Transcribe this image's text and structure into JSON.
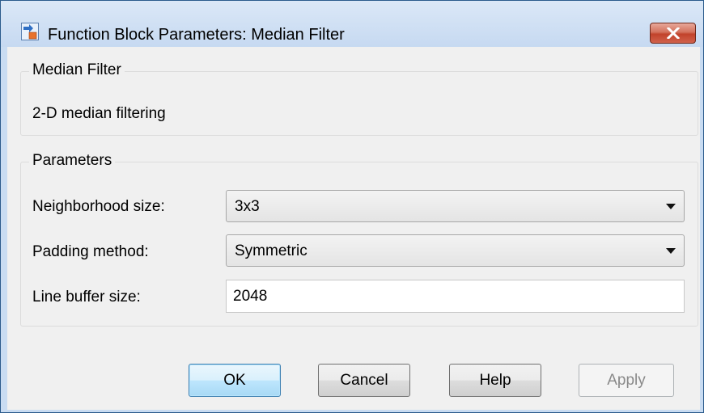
{
  "window": {
    "title": "Function Block Parameters: Median Filter"
  },
  "block_group": {
    "legend": "Median Filter",
    "description": "2-D median filtering"
  },
  "parameters_group": {
    "legend": "Parameters",
    "fields": [
      {
        "label": "Neighborhood size:",
        "value": "3x3",
        "type": "dropdown"
      },
      {
        "label": "Padding method:",
        "value": "Symmetric",
        "type": "dropdown"
      },
      {
        "label": "Line buffer size:",
        "value": "2048",
        "type": "text"
      }
    ]
  },
  "buttons": {
    "ok": "OK",
    "cancel": "Cancel",
    "help": "Help",
    "apply": "Apply"
  },
  "colors": {
    "close_button": "#c2432b",
    "client_bg": "#f0f0f0",
    "primary_button_border": "#3c7fb1"
  },
  "icons": {
    "app": "simulink-block-icon",
    "close": "close-icon"
  }
}
